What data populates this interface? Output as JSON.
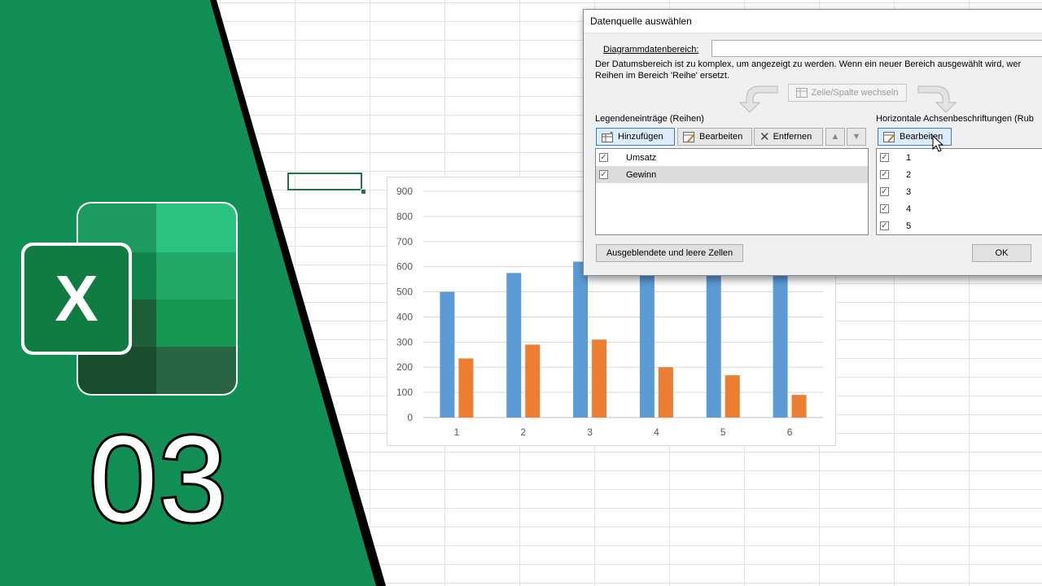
{
  "colors": {
    "excel_green": "#107c41",
    "banner_green": "#128f54",
    "series_umsatz": "#5b9bd5",
    "series_gewinn": "#ed7d31"
  },
  "banner": {
    "episode_number": "03",
    "logo_letter": "X"
  },
  "dialog": {
    "title": "Datenquelle auswählen",
    "range_label": "Diagrammdatenbereich:",
    "range_value": "",
    "note_line1": "Der Datumsbereich ist zu komplex, um angezeigt zu werden. Wenn ein neuer Bereich ausgewählt wird, wer",
    "note_line2": "Reihen im Bereich 'Reihe' ersetzt.",
    "swap_label": "Zeile/Spalte wechseln",
    "legend_section_label": "Legendeneinträge (Reihen)",
    "axis_section_label": "Horizontale Achsenbeschriftungen (Rub",
    "legend_buttons": {
      "add": "Hinzufügen",
      "edit": "Bearbeiten",
      "remove": "Entfernen"
    },
    "axis_edit_label": "Bearbeiten",
    "series": [
      {
        "name": "Umsatz",
        "checked": true
      },
      {
        "name": "Gewinn",
        "checked": true
      }
    ],
    "axis_labels": [
      "1",
      "2",
      "3",
      "4",
      "5"
    ],
    "hidden_cells_button": "Ausgeblendete und leere Zellen",
    "ok_button": "OK"
  },
  "chart_data": {
    "type": "bar",
    "categories": [
      "1",
      "2",
      "3",
      "4",
      "5",
      "6"
    ],
    "series": [
      {
        "name": "Umsatz",
        "values": [
          500,
          575,
          620,
          630,
          650,
          640
        ]
      },
      {
        "name": "Gewinn",
        "values": [
          235,
          290,
          310,
          200,
          168,
          90
        ]
      }
    ],
    "ylim": [
      0,
      900
    ],
    "yticks": [
      0,
      100,
      200,
      300,
      400,
      500,
      600,
      700,
      800,
      900
    ],
    "grid": true,
    "title": "",
    "xlabel": "",
    "ylabel": ""
  }
}
